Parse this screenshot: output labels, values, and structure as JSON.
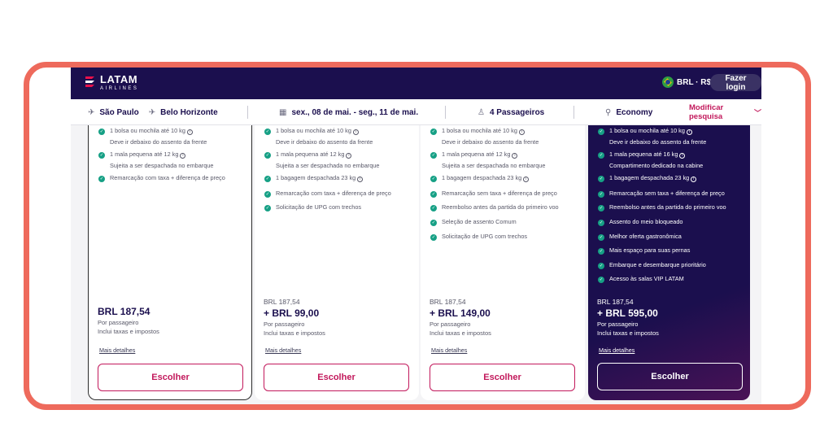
{
  "header": {
    "logo_main": "LATAM",
    "logo_sub": "AIRLINES",
    "currency": "BRL · R$",
    "login_label": "Fazer login"
  },
  "search": {
    "origin": "São Paulo",
    "destination": "Belo Horizonte",
    "dates": "sex., 08 de mai. - seg., 11 de mai.",
    "passengers": "4 Passageiros",
    "cabin": "Economy",
    "modify_label": "Modificar pesquisa"
  },
  "colors": {
    "brand_navy": "#1b0f4e",
    "accent_magenta": "#c2185b",
    "check_green": "#16a085",
    "frame_coral": "#ee6a5c"
  },
  "cards": [
    {
      "features": [
        {
          "text": "1 bolsa ou mochila até 10 kg",
          "info": true,
          "sub": "Deve ir debaixo do assento da frente"
        },
        {
          "text": "1 mala pequena até 12 kg",
          "info": true,
          "sub": "Sujeita a ser despachada no embarque"
        },
        {
          "text": "Remarcação com taxa + diferença de preço",
          "info": false,
          "sub": ""
        }
      ],
      "base_price": "",
      "price": "BRL 187,54",
      "per_passenger": "Por passageiro",
      "taxes": "Inclui taxas e impostos",
      "details_label": "Mais detalhes",
      "choose_label": "Escolher"
    },
    {
      "features": [
        {
          "text": "1 bolsa ou mochila até 10 kg",
          "info": true,
          "sub": "Deve ir debaixo do assento da frente"
        },
        {
          "text": "1 mala pequena até 12 kg",
          "info": true,
          "sub": "Sujeita a ser despachada no embarque"
        },
        {
          "text": "1 bagagem despachada 23 kg",
          "info": true,
          "sub": ""
        },
        {
          "text": "Remarcação com taxa + diferença de preço",
          "info": false,
          "sub": ""
        },
        {
          "text": "Solicitação de UPG com trechos",
          "info": false,
          "sub": ""
        }
      ],
      "base_price": "BRL 187,54",
      "price": "+ BRL 99,00",
      "per_passenger": "Por passageiro",
      "taxes": "Inclui taxas e impostos",
      "details_label": "Mais detalhes",
      "choose_label": "Escolher"
    },
    {
      "features": [
        {
          "text": "1 bolsa ou mochila até 10 kg",
          "info": true,
          "sub": "Deve ir debaixo do assento da frente"
        },
        {
          "text": "1 mala pequena até 12 kg",
          "info": true,
          "sub": "Sujeita a ser despachada no embarque"
        },
        {
          "text": "1 bagagem despachada 23 kg",
          "info": true,
          "sub": ""
        },
        {
          "text": "Remarcação sem taxa + diferença de preço",
          "info": false,
          "sub": ""
        },
        {
          "text": "Reembolso antes da partida do primeiro voo",
          "info": false,
          "sub": ""
        },
        {
          "text": "Seleção de assento Comum",
          "info": false,
          "sub": ""
        },
        {
          "text": "Solicitação de UPG com trechos",
          "info": false,
          "sub": ""
        }
      ],
      "base_price": "BRL 187,54",
      "price": "+ BRL 149,00",
      "per_passenger": "Por passageiro",
      "taxes": "Inclui taxas e impostos",
      "details_label": "Mais detalhes",
      "choose_label": "Escolher"
    },
    {
      "features": [
        {
          "text": "1 bolsa ou mochila até 10 kg",
          "info": true,
          "sub": "Deve ir debaixo do assento da frente"
        },
        {
          "text": "1 mala pequena até 16 kg",
          "info": true,
          "sub": "Compartimento dedicado na cabine"
        },
        {
          "text": "1 bagagem despachada 23 kg",
          "info": true,
          "sub": ""
        },
        {
          "text": "Remarcação sem taxa + diferença de preço",
          "info": false,
          "sub": ""
        },
        {
          "text": "Reembolso antes da partida do primeiro voo",
          "info": false,
          "sub": ""
        },
        {
          "text": "Assento do meio bloqueado",
          "info": false,
          "sub": ""
        },
        {
          "text": "Melhor oferta gastronômica",
          "info": false,
          "sub": ""
        },
        {
          "text": "Mais espaço para suas pernas",
          "info": false,
          "sub": ""
        },
        {
          "text": "Embarque e desembarque prioritário",
          "info": false,
          "sub": ""
        },
        {
          "text": "Acesso às salas VIP LATAM",
          "info": false,
          "sub": ""
        }
      ],
      "base_price": "BRL 187,54",
      "price": "+ BRL 595,00",
      "per_passenger": "Por passageiro",
      "taxes": "Inclui taxas e impostos",
      "details_label": "Mais detalhes",
      "choose_label": "Escolher"
    }
  ]
}
